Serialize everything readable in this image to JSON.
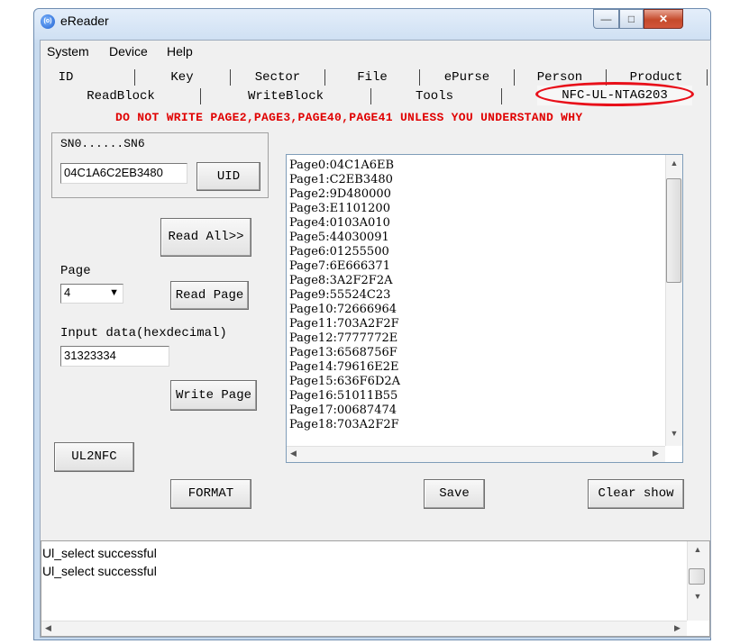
{
  "window": {
    "title": "eReader"
  },
  "menu": [
    "System",
    "Device",
    "Help"
  ],
  "tabs_row1": [
    "ID",
    "Key",
    "Sector",
    "File",
    "ePurse",
    "Person",
    "Product"
  ],
  "tabs_row2": [
    "ReadBlock",
    "WriteBlock",
    "Tools",
    "NFC-UL-NTAG203"
  ],
  "warning": "DO NOT WRITE PAGE2,PAGE3,PAGE40,PAGE41 UNLESS YOU UNDERSTAND WHY",
  "sn": {
    "label": "SN0......SN6",
    "value": "04C1A6C2EB3480",
    "uid_button": "UID"
  },
  "buttons": {
    "read_all": "Read All>>",
    "read_page": "Read Page",
    "write_page": "Write Page",
    "ul2nfc": "UL2NFC",
    "format": "FORMAT",
    "save": "Save",
    "clear_show": "Clear show"
  },
  "page": {
    "label": "Page",
    "selected": "4"
  },
  "input_data": {
    "label": "Input data(hexdecimal)",
    "value": "31323334"
  },
  "page_list": [
    "Page0:04C1A6EB",
    "Page1:C2EB3480",
    "Page2:9D480000",
    "Page3:E1101200",
    "Page4:0103A010",
    "Page5:44030091",
    "Page6:01255500",
    "Page7:6E666371",
    "Page8:3A2F2F2A",
    "Page9:55524C23",
    "Page10:72666964",
    "Page11:703A2F2F",
    "Page12:7777772E",
    "Page13:6568756F",
    "Page14:79616E2E",
    "Page15:636F6D2A",
    "Page16:51011B55",
    "Page17:00687474",
    "Page18:703A2F2F"
  ],
  "log": [
    "Ul_select successful",
    "Ul_select successful"
  ],
  "colors": {
    "warning": "#e00000",
    "highlight_oval": "#e8101a",
    "title_bar": "#cfe0f3"
  }
}
